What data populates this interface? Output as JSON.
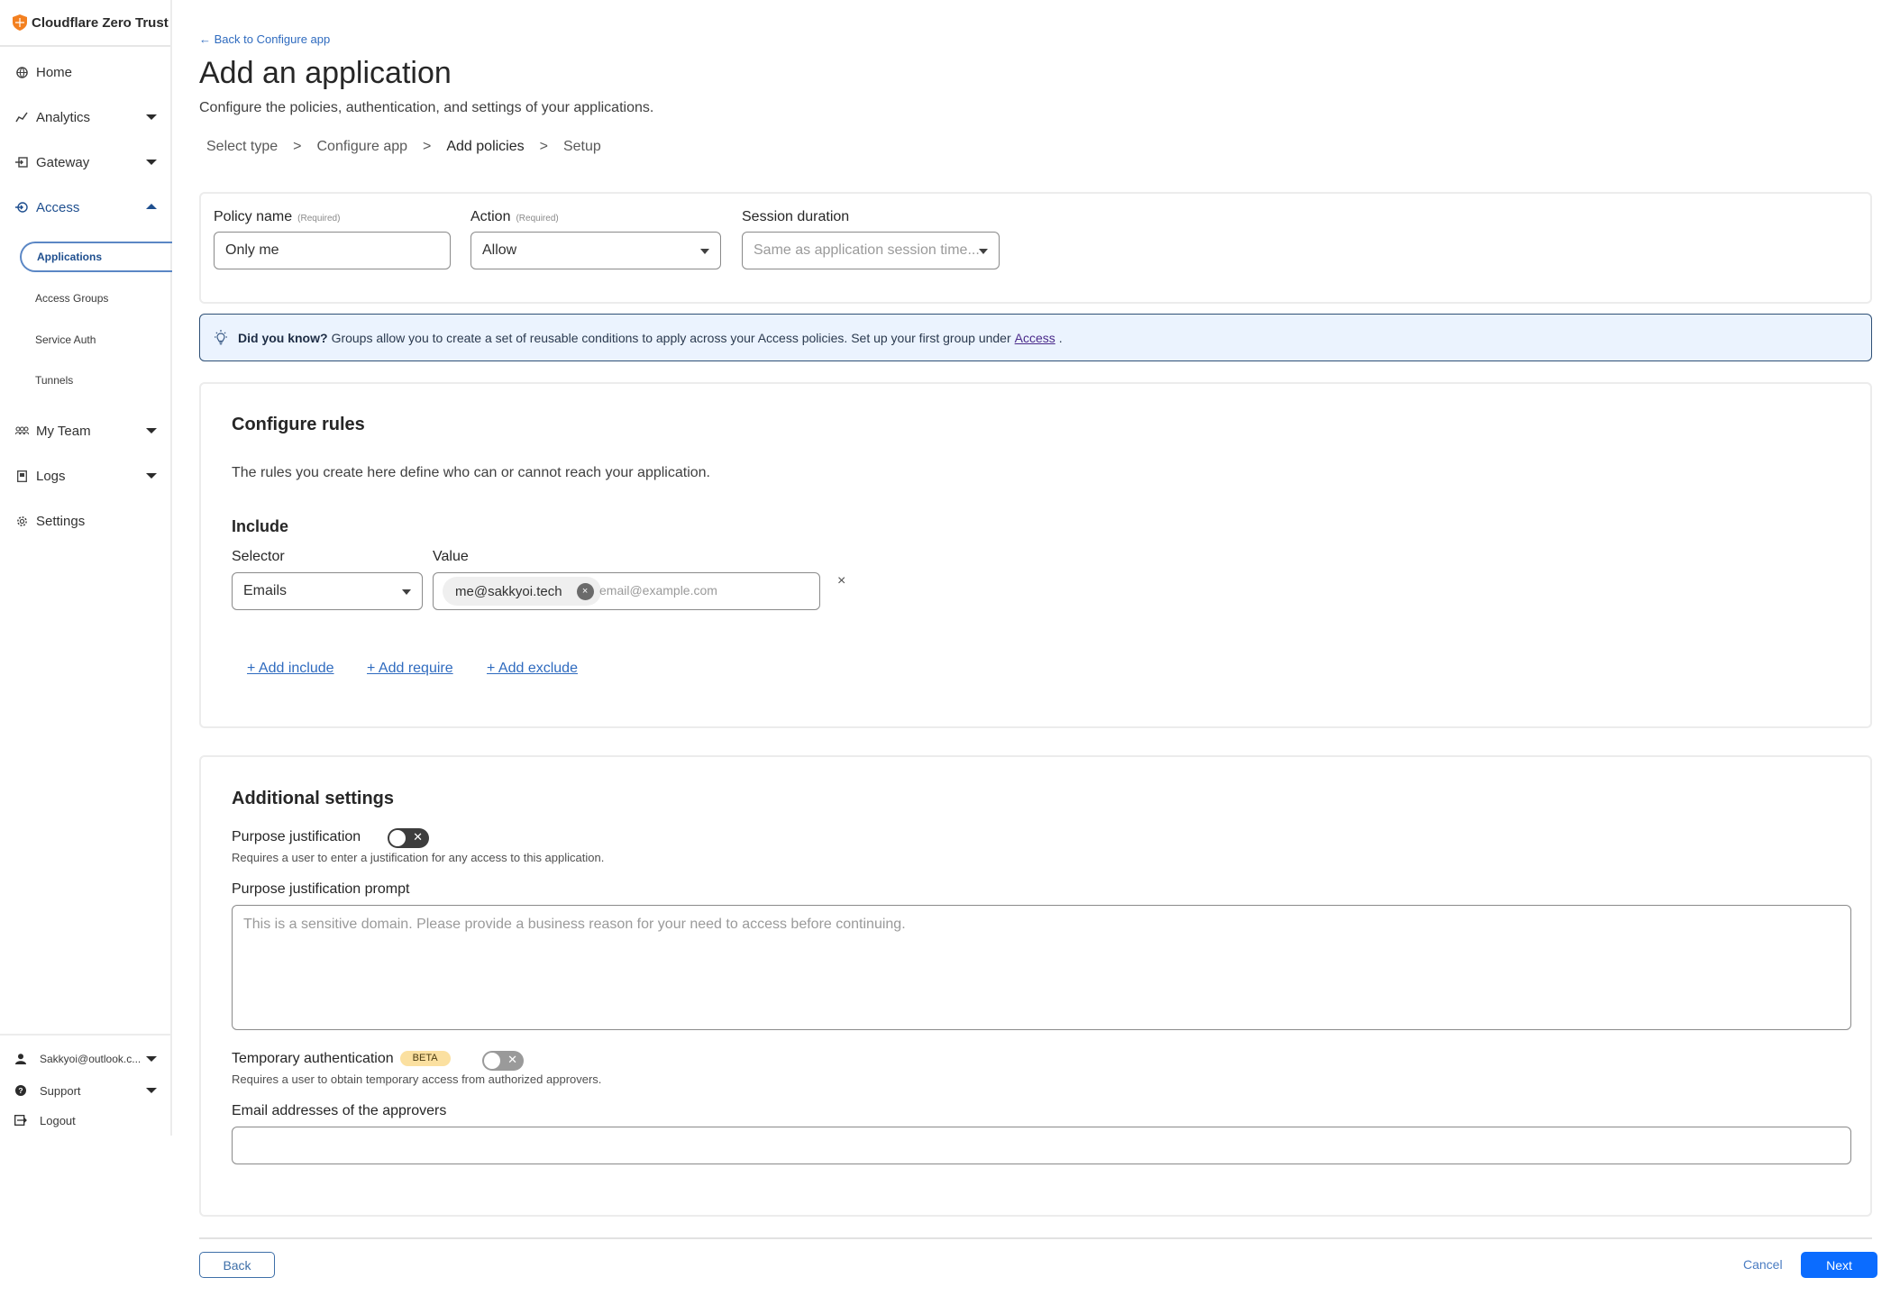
{
  "brand": {
    "name": "Cloudflare Zero Trust",
    "accent": "#f38020"
  },
  "sidebar": {
    "items": [
      {
        "label": "Home",
        "icon": "globe-icon"
      },
      {
        "label": "Analytics",
        "icon": "analytics-icon"
      },
      {
        "label": "Gateway",
        "icon": "gateway-icon"
      },
      {
        "label": "Access",
        "icon": "access-icon"
      },
      {
        "label": "My Team",
        "icon": "team-icon"
      },
      {
        "label": "Logs",
        "icon": "logs-icon"
      },
      {
        "label": "Settings",
        "icon": "gear-icon"
      }
    ],
    "access_sub": [
      {
        "label": "Applications"
      },
      {
        "label": "Access Groups"
      },
      {
        "label": "Service Auth"
      },
      {
        "label": "Tunnels"
      }
    ],
    "footer": {
      "account": "Sakkyoi@outlook.c...",
      "support": "Support",
      "logout": "Logout"
    }
  },
  "header": {
    "back_link": "← Back to Configure app",
    "title": "Add an application",
    "subtitle": "Configure the policies, authentication, and settings of your applications.",
    "steps": [
      "Select type",
      "Configure app",
      "Add policies",
      "Setup"
    ],
    "step_separator": ">",
    "current_step": "Add policies"
  },
  "policy": {
    "name_label": "Policy name",
    "name_required": "(Required)",
    "name_value": "Only me",
    "action_label": "Action",
    "action_required": "(Required)",
    "action_value": "Allow",
    "session_label": "Session duration",
    "session_placeholder": "Same as application session time..."
  },
  "info": {
    "title": "Did you know?",
    "text": "Groups allow you to create a set of reusable conditions to apply across your Access policies. Set up your first group under",
    "link": "Access",
    "suffix": "."
  },
  "rules": {
    "title": "Configure rules",
    "description": "The rules you create here define who can or cannot reach your application.",
    "include_title": "Include",
    "selector_label": "Selector",
    "selector_value": "Emails",
    "value_label": "Value",
    "chip": "me@sakkyoi.tech",
    "value_placeholder": "email@example.com",
    "remove_row": "×",
    "add_include": "+ Add include",
    "add_require": "+ Add require",
    "add_exclude": "+ Add exclude"
  },
  "additional": {
    "title": "Additional settings",
    "purpose_label": "Purpose justification",
    "purpose_enabled": false,
    "purpose_help": "Requires a user to enter a justification for any access to this application.",
    "prompt_label": "Purpose justification prompt",
    "prompt_placeholder": "This is a sensitive domain. Please provide a business reason for your need to access before continuing.",
    "temp_label": "Temporary authentication",
    "temp_badge": "BETA",
    "temp_enabled": false,
    "temp_help": "Requires a user to obtain temporary access from authorized approvers.",
    "approvers_label": "Email addresses of the approvers",
    "approvers_value": ""
  },
  "footer": {
    "back": "Back",
    "cancel": "Cancel",
    "next": "Next",
    "primary_color": "#0b6cff"
  }
}
